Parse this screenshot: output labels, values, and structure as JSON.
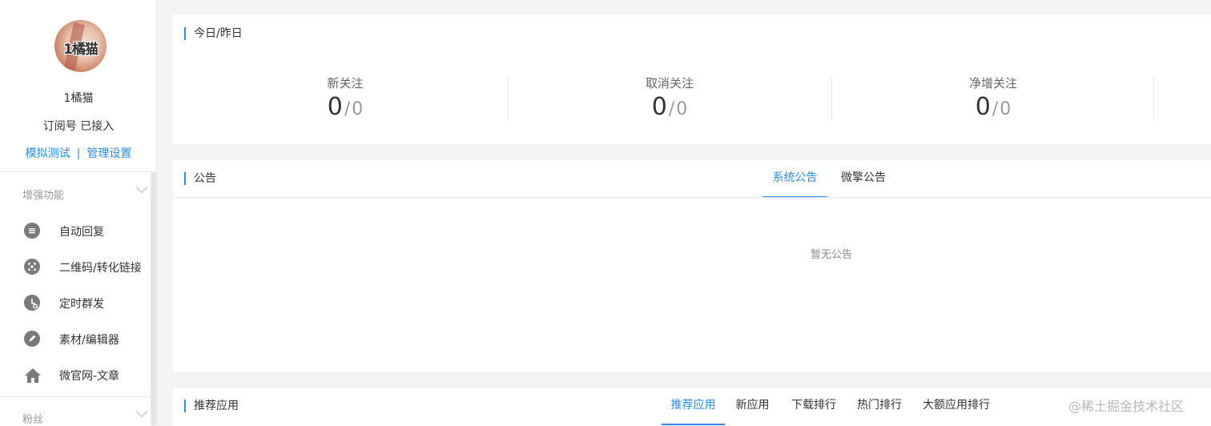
{
  "sidebar": {
    "avatar_text": "1橘猫",
    "account_name": "1橘猫",
    "account_type": "订阅号 已接入",
    "links": {
      "simulate": "模拟测试",
      "separator": "|",
      "manage": "管理设置"
    },
    "sections": [
      {
        "title": "增强功能",
        "items": [
          {
            "label": "自动回复",
            "icon": "chat-bubble-icon"
          },
          {
            "label": "二维码/转化链接",
            "icon": "qrcode-icon"
          },
          {
            "label": "定时群发",
            "icon": "clock-icon"
          },
          {
            "label": "素材/编辑器",
            "icon": "pencil-icon"
          },
          {
            "label": "微官网-文章",
            "icon": "home-icon"
          }
        ]
      },
      {
        "title": "粉丝",
        "items": []
      }
    ]
  },
  "stats": {
    "title": "今日/昨日",
    "items": [
      {
        "label": "新关注",
        "today": "0",
        "sep": "/",
        "yesterday": "0"
      },
      {
        "label": "取消关注",
        "today": "0",
        "sep": "/",
        "yesterday": "0"
      },
      {
        "label": "净增关注",
        "today": "0",
        "sep": "/",
        "yesterday": "0"
      }
    ]
  },
  "notices": {
    "title": "公告",
    "tabs": [
      "系统公告",
      "微擎公告"
    ],
    "active_tab": "系统公告",
    "empty_text": "暂无公告"
  },
  "recommend": {
    "title": "推荐应用",
    "tabs": [
      "推荐应用",
      "新应用",
      "下载排行",
      "热门排行",
      "大额应用排行"
    ],
    "active_tab": "推荐应用"
  },
  "watermark": "@稀土掘金技术社区",
  "colors": {
    "accent": "#2d8cf0",
    "background": "#f3f4f6",
    "icon_gray": "#7a7a7a"
  }
}
